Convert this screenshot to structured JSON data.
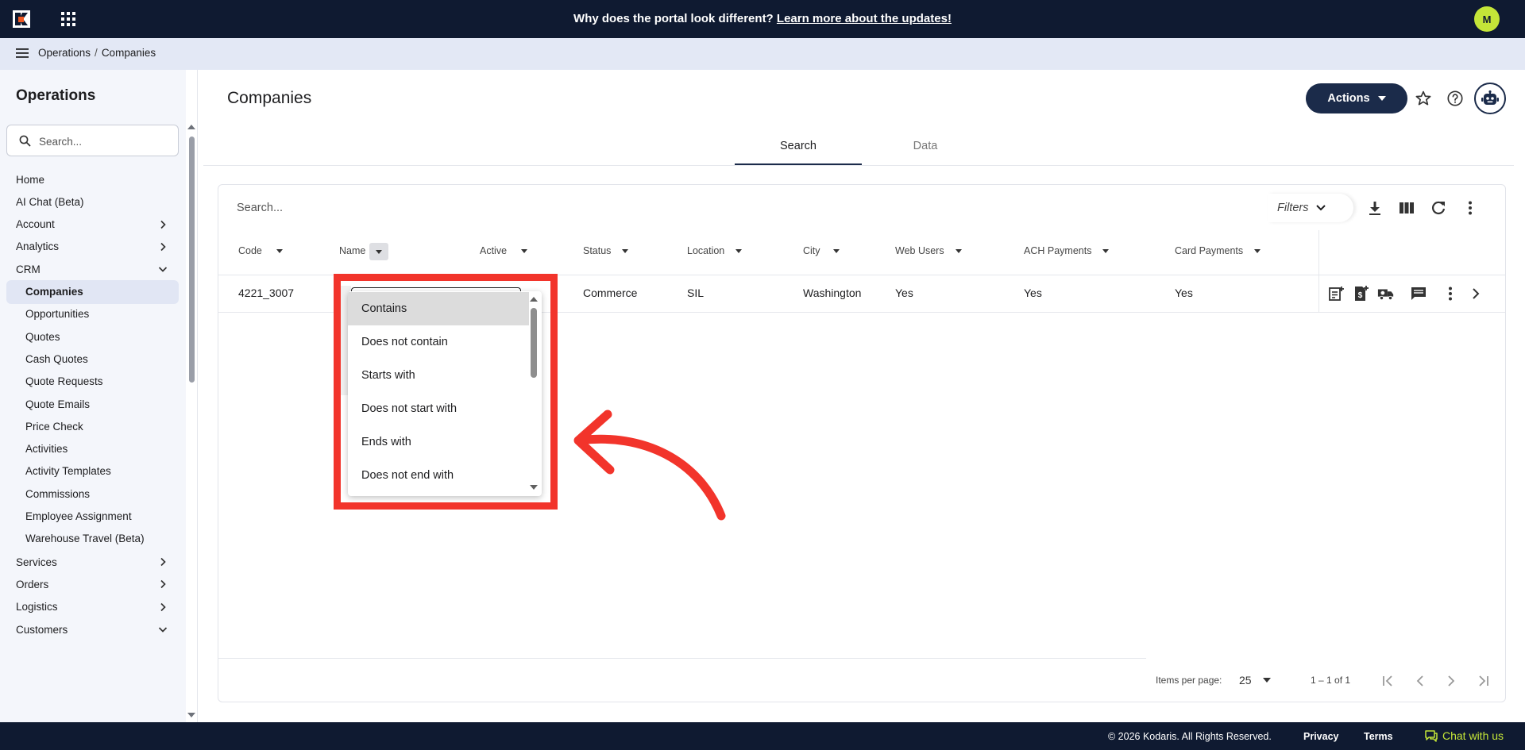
{
  "topbar": {
    "announcement": "Why does the portal look different?",
    "announcement_link": "Learn more about the updates!",
    "user_initial": "M"
  },
  "breadcrumb": {
    "items": [
      "Operations",
      "Companies"
    ]
  },
  "sidebar": {
    "title": "Operations",
    "search_placeholder": "Search...",
    "items": [
      {
        "label": "Home",
        "level": "top",
        "chevron": "none"
      },
      {
        "label": "AI Chat (Beta)",
        "level": "top",
        "chevron": "none"
      },
      {
        "label": "Account",
        "level": "top",
        "chevron": "right"
      },
      {
        "label": "Analytics",
        "level": "top",
        "chevron": "right"
      },
      {
        "label": "CRM",
        "level": "top",
        "chevron": "down"
      },
      {
        "label": "Companies",
        "level": "sub",
        "active": true
      },
      {
        "label": "Opportunities",
        "level": "sub"
      },
      {
        "label": "Quotes",
        "level": "sub"
      },
      {
        "label": "Cash Quotes",
        "level": "sub"
      },
      {
        "label": "Quote Requests",
        "level": "sub"
      },
      {
        "label": "Quote Emails",
        "level": "sub"
      },
      {
        "label": "Price Check",
        "level": "sub"
      },
      {
        "label": "Activities",
        "level": "sub"
      },
      {
        "label": "Activity Templates",
        "level": "sub"
      },
      {
        "label": "Commissions",
        "level": "sub"
      },
      {
        "label": "Employee Assignment",
        "level": "sub"
      },
      {
        "label": "Warehouse Travel (Beta)",
        "level": "sub"
      },
      {
        "label": "Services",
        "level": "top",
        "chevron": "right"
      },
      {
        "label": "Orders",
        "level": "top",
        "chevron": "right"
      },
      {
        "label": "Logistics",
        "level": "top",
        "chevron": "right"
      },
      {
        "label": "Customers",
        "level": "top",
        "chevron": "down"
      }
    ]
  },
  "page": {
    "title": "Companies",
    "actions_label": "Actions",
    "tabs": [
      {
        "label": "Search",
        "active": true
      },
      {
        "label": "Data",
        "active": false
      }
    ]
  },
  "grid": {
    "search_placeholder": "Search...",
    "filters_label": "Filters",
    "columns": [
      "Code",
      "Name",
      "Active",
      "Status",
      "Location",
      "City",
      "Web Users",
      "ACH Payments",
      "Card Payments"
    ],
    "rows": [
      {
        "code": "4221_3007",
        "status": "Commerce",
        "location": "SIL",
        "city": "Washington",
        "web_users": "Yes",
        "ach": "Yes",
        "card": "Yes"
      }
    ],
    "footer": {
      "items_per_page_label": "Items per page:",
      "items_per_page": "25",
      "range": "1 – 1 of 1"
    }
  },
  "filter_dropdown": {
    "options": [
      "Contains",
      "Does not contain",
      "Starts with",
      "Does not start with",
      "Ends with",
      "Does not end with"
    ],
    "selected": "Contains"
  },
  "footer": {
    "copyright": "© 2026 Kodaris. All Rights Reserved.",
    "privacy": "Privacy",
    "terms": "Terms",
    "chat": "Chat with us"
  },
  "colors": {
    "navy": "#0f1a31",
    "accent_lime": "#c4e538",
    "button_navy": "#1b2b4a",
    "annotation_red": "#f2342b"
  }
}
